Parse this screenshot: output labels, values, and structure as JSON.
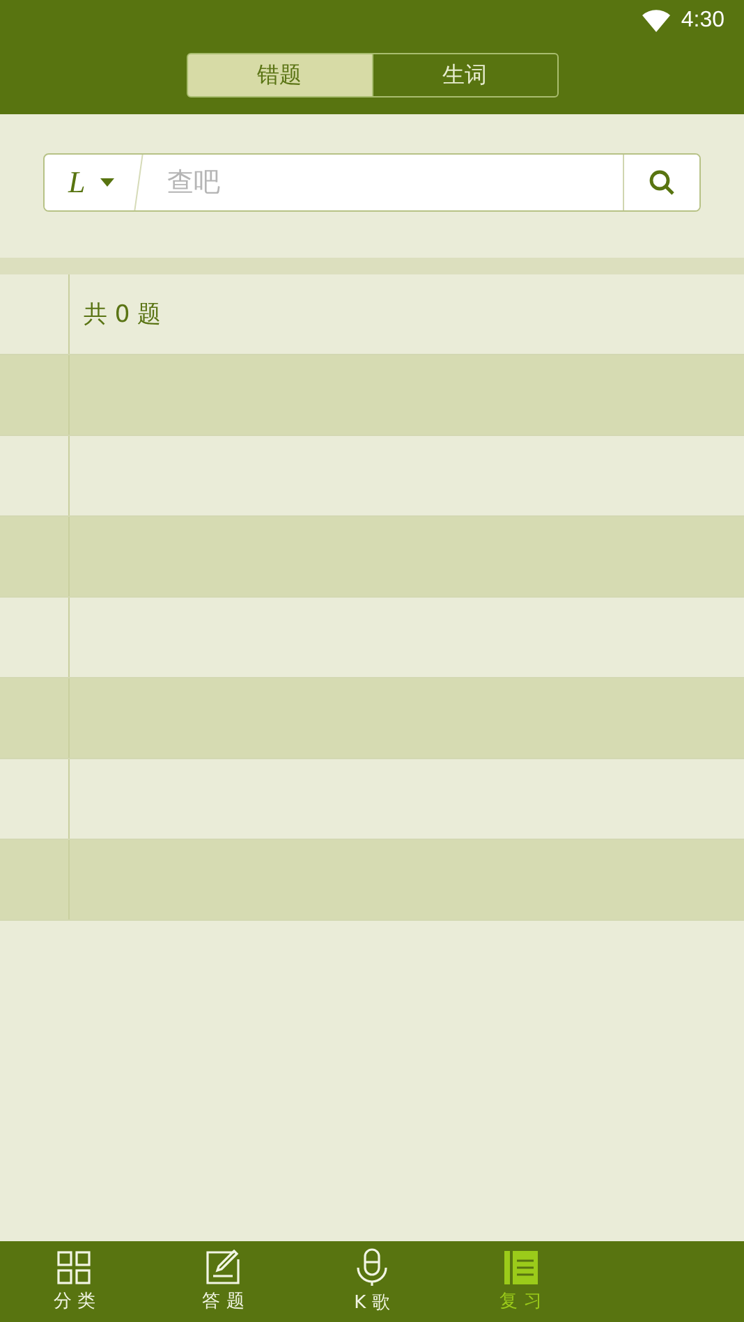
{
  "status_bar": {
    "time": "4:30"
  },
  "tabs": [
    {
      "label": "错题",
      "selected": true
    },
    {
      "label": "生词",
      "selected": false
    }
  ],
  "search": {
    "language": "L",
    "placeholder": "查吧"
  },
  "list": {
    "summary": "共 0 题",
    "rows": [
      {
        "shaded": true
      },
      {
        "shaded": false
      },
      {
        "shaded": true
      },
      {
        "shaded": false
      },
      {
        "shaded": true
      },
      {
        "shaded": false
      },
      {
        "shaded": true
      }
    ]
  },
  "bottom_nav": [
    {
      "kind": "grid",
      "label": "分 类",
      "selected": false
    },
    {
      "kind": "edit",
      "label": "答 题",
      "selected": false
    },
    {
      "kind": "mic",
      "label": "K 歌",
      "selected": false
    },
    {
      "kind": "list",
      "label": "复 习",
      "selected": true
    }
  ]
}
